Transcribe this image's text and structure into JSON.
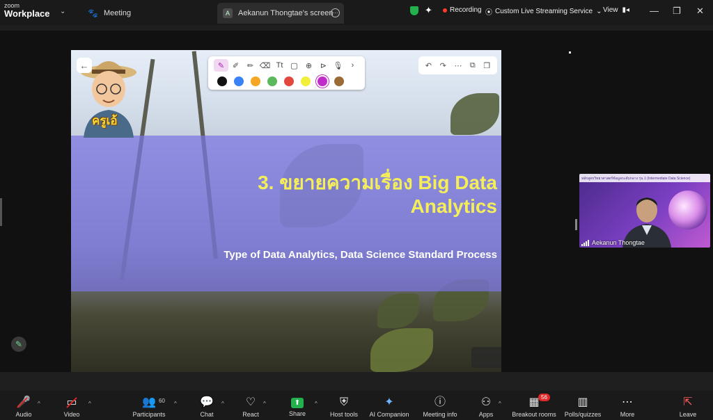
{
  "app": {
    "brand_top": "zoom",
    "brand_bottom": "Workplace"
  },
  "tabs": {
    "meeting": "Meeting",
    "screen": "Aekanun Thongtae's screen",
    "screen_avatar": "A"
  },
  "top_right": {
    "recording": "Recording",
    "streaming": "Custom Live Streaming Service",
    "view": "View"
  },
  "slide": {
    "title_line1": "3. ขยายความเรื่อง  Big Data",
    "title_line2": "Analytics",
    "subtitle": "Type of Data Analytics, Data Science Standard Process",
    "avatar_caption": "ครูเอ้"
  },
  "annotation": {
    "swatches": [
      "#111111",
      "#3b82f6",
      "#f5a623",
      "#5cb85c",
      "#e2483d",
      "#f2ef3a",
      "#c12bc9",
      "#9a6b35"
    ]
  },
  "participant": {
    "name": "Aekanun Thongtae",
    "header": "หลักสูตรวิทยาศาสตร์ข้อมูลระดับกลาง รุ่น 1 (Intermediate Data Science)"
  },
  "controls": {
    "audio": "Audio",
    "video": "Video",
    "participants": "Participants",
    "participants_count": "60",
    "chat": "Chat",
    "react": "React",
    "share": "Share",
    "host_tools": "Host tools",
    "ai_companion": "AI Companion",
    "meeting_info": "Meeting info",
    "apps": "Apps",
    "breakout_rooms": "Breakout rooms",
    "breakout_badge": "56",
    "polls": "Polls/quizzes",
    "more": "More",
    "leave": "Leave"
  },
  "colors": {
    "accent_green": "#23b14d",
    "record_red": "#ff3b30",
    "slide_band": "#7a74e2",
    "slide_title": "#f4ee5a"
  }
}
